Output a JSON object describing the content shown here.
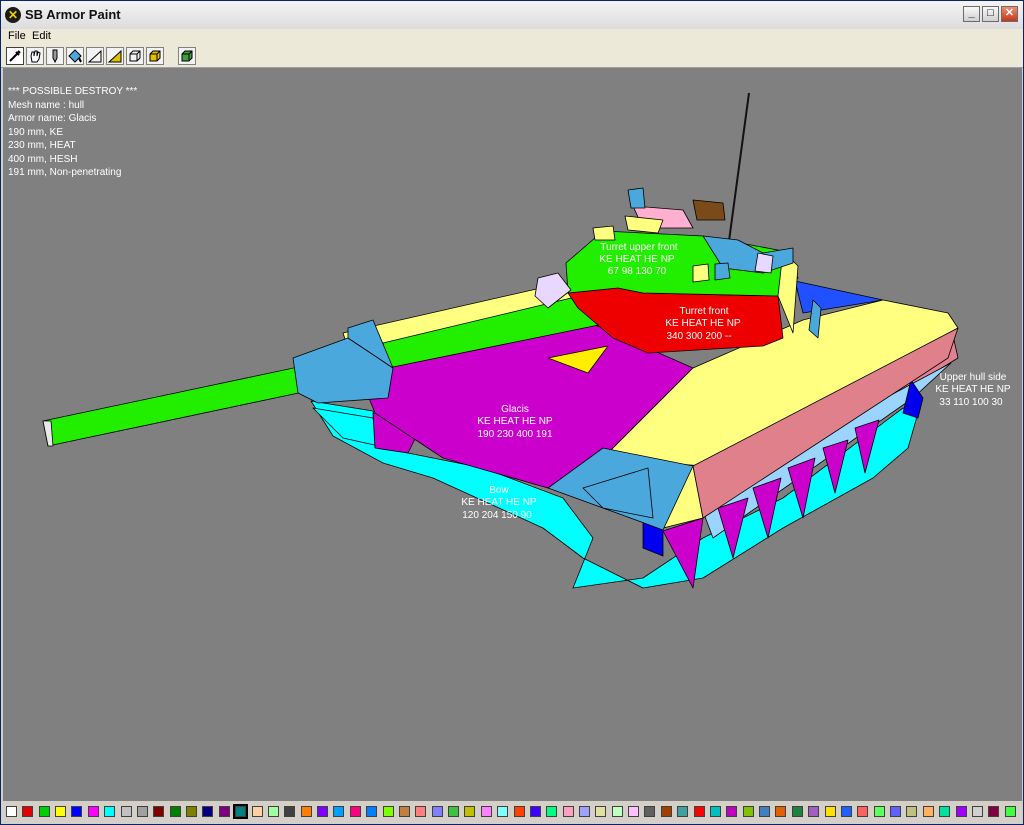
{
  "window": {
    "title": "SB Armor Paint",
    "icon": "sb-app-icon",
    "controls": [
      "minimize",
      "maximize",
      "close"
    ]
  },
  "menu": {
    "file": "File",
    "edit": "Edit"
  },
  "toolbar": {
    "tools": [
      {
        "icon": "eyedropper-icon"
      },
      {
        "icon": "hand-icon"
      },
      {
        "icon": "pen-icon"
      },
      {
        "icon": "paint-icon"
      },
      {
        "icon": "triangle-outline-icon"
      },
      {
        "icon": "triangle-filled-icon"
      },
      {
        "icon": "cube-outline-icon"
      },
      {
        "icon": "cube-solid-icon"
      },
      {
        "icon": "cube-shaded-icon"
      }
    ]
  },
  "info": {
    "status": "*** POSSIBLE DESTROY ***",
    "mesh": "Mesh name :  hull",
    "armor": "Armor name: Glacis",
    "ke": "190 mm, KE",
    "heat": "230 mm, HEAT",
    "hesh": "400 mm, HESH",
    "np": "191 mm, Non-penetrating"
  },
  "labels": {
    "turret_upper": {
      "name": "Turret upper front",
      "header": "KE  HEAT  HE  NP",
      "values": "67   98   130   70"
    },
    "turret_front": {
      "name": "Turret front",
      "header": "KE  HEAT  HE  NP",
      "values": "340  300   200   --"
    },
    "glacis": {
      "name": "Glacis",
      "header": "KE  HEAT  HE  NP",
      "values": "190  230  400  191"
    },
    "bow": {
      "name": "Bow",
      "header": "KE  HEAT  HE  NP",
      "values": "120  204  150   90"
    },
    "upper_hull_side": {
      "name": "Upper hull side",
      "header": "KE  HEAT  HE  NP",
      "values": "33   110    100   30"
    }
  },
  "colors": {
    "viewport_bg": "#808080",
    "green": "#22ee00",
    "red": "#ee0000",
    "magenta": "#cc00cc",
    "yellow": "#ffff80",
    "cyan": "#00ffff",
    "steelblue": "#4aa8dc",
    "pink": "#e0808a"
  },
  "palette": {
    "selected_index": 14,
    "swatches": [
      "#ffffff",
      "#e00000",
      "#00d000",
      "#ffff00",
      "#0000ff",
      "#ff00ff",
      "#00ffff",
      "#c0c0c0",
      "#a0a0a0",
      "#800000",
      "#008000",
      "#808000",
      "#000080",
      "#800080",
      "#008080",
      "#ffd0a0",
      "#a0ffa0",
      "#404040",
      "#ff8000",
      "#8000ff",
      "#00a0ff",
      "#ff0080",
      "#0080ff",
      "#80ff00",
      "#c08040",
      "#ff8080",
      "#8080ff",
      "#40c040",
      "#c0c000",
      "#ff80ff",
      "#80ffff",
      "#ff4000",
      "#4000ff",
      "#00ff80",
      "#ffa0c0",
      "#a0a0ff",
      "#e0e0a0",
      "#c0ffc0",
      "#ffc0ff",
      "#606060",
      "#a04000",
      "#40a0a0",
      "#ff0000",
      "#00c0c0",
      "#c000c0",
      "#80c000",
      "#4080c0",
      "#e06000",
      "#208040",
      "#a060c0",
      "#ffe000",
      "#2060ff",
      "#ff6060",
      "#60ff60",
      "#6060ff",
      "#c0c080",
      "#ffb060",
      "#00e0a0",
      "#a000ff",
      "#d0d0d0",
      "#800040",
      "#40ff40"
    ]
  }
}
